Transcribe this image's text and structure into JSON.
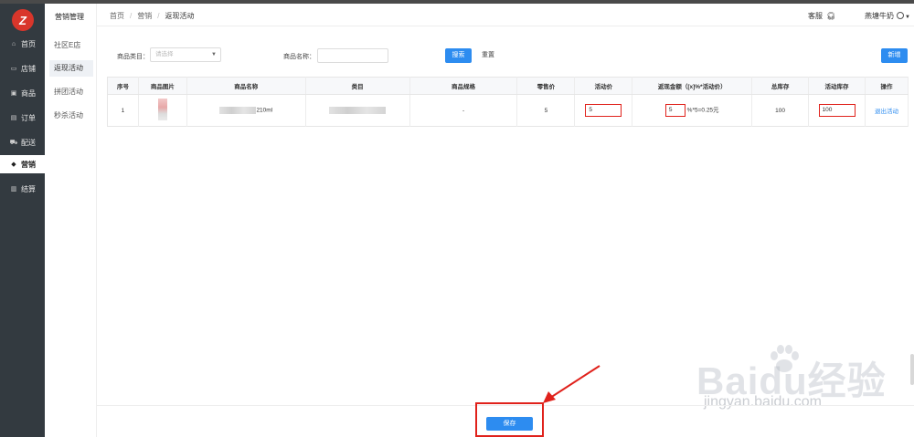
{
  "logo": {
    "glyph": "Z"
  },
  "sidebar": {
    "items": [
      {
        "label": "首页",
        "icon": "home-icon",
        "glyph": "⌂"
      },
      {
        "label": "店铺",
        "icon": "store-icon",
        "glyph": "▭"
      },
      {
        "label": "商品",
        "icon": "product-icon",
        "glyph": "▣"
      },
      {
        "label": "订单",
        "icon": "order-icon",
        "glyph": "▤"
      },
      {
        "label": "配送",
        "icon": "truck-icon",
        "glyph": "⛟"
      },
      {
        "label": "营销",
        "icon": "tag-icon",
        "glyph": "◆"
      },
      {
        "label": "结算",
        "icon": "settlement-icon",
        "glyph": "▥"
      }
    ],
    "active_index": 5
  },
  "submenu": {
    "title": "营销管理",
    "items": [
      "社区E店",
      "返现活动",
      "拼团活动",
      "秒杀活动"
    ],
    "active_index": 1
  },
  "header": {
    "breadcrumb": [
      "首页",
      "营销",
      "返现活动"
    ],
    "service_label": "客服",
    "user_name": "燕塘牛奶"
  },
  "filters": {
    "category_label": "商品类目：",
    "category_placeholder": "请选择",
    "name_label": "商品名称：",
    "search_label": "搜索",
    "reset_label": "重置",
    "new_label": "新增"
  },
  "table": {
    "columns": [
      "序号",
      "商品图片",
      "商品名称",
      "类目",
      "商品规格",
      "零售价",
      "活动价",
      "返现金额（[x]%*活动价）",
      "总库存",
      "活动库存",
      "操作"
    ],
    "rows": [
      {
        "index": "1",
        "name_suffix": "210ml",
        "spec": "-",
        "retail_price": "5",
        "activity_price": "5",
        "cashback_percent": "5",
        "cashback_formula": "%*5=0.25元",
        "total_stock": "100",
        "activity_stock": "100",
        "action": "退出活动"
      }
    ]
  },
  "footer": {
    "save_label": "保存"
  },
  "watermark": {
    "brand": "Baidu经验",
    "url": "jingyan.baidu.com"
  },
  "colors": {
    "primary": "#2d8cf0",
    "highlight": "#e0211b",
    "sidebar": "#333a40",
    "logo": "#d9362b"
  }
}
